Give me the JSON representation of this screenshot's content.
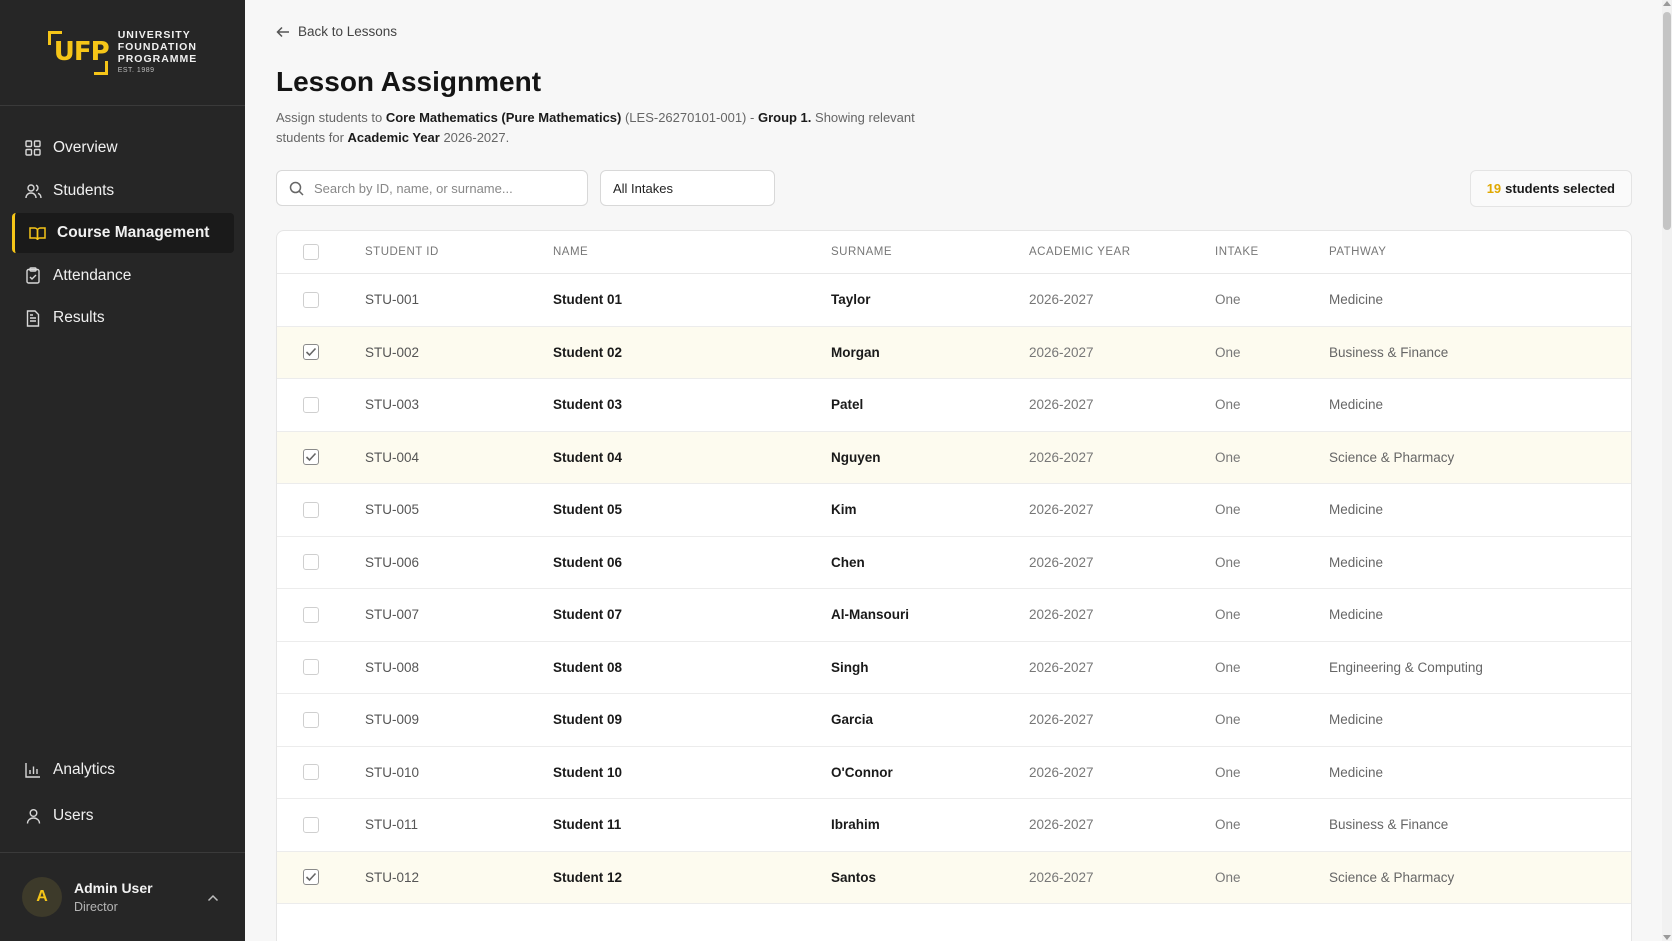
{
  "brand": {
    "logo_letters": "UFP",
    "line1": "UNIVERSITY",
    "line2": "FOUNDATION",
    "line3": "PROGRAMME",
    "est": "EST. 1989",
    "accent_color": "#f5c518"
  },
  "sidebar": {
    "items": [
      {
        "label": "Overview",
        "icon": "grid-icon"
      },
      {
        "label": "Students",
        "icon": "users-icon"
      },
      {
        "label": "Course Management",
        "icon": "book-icon",
        "active": true
      },
      {
        "label": "Attendance",
        "icon": "clipboard-check-icon"
      },
      {
        "label": "Results",
        "icon": "document-icon"
      }
    ],
    "bottom_items": [
      {
        "label": "Analytics",
        "icon": "bar-chart-icon"
      },
      {
        "label": "Users",
        "icon": "user-icon"
      }
    ]
  },
  "user": {
    "initial": "A",
    "name": "Admin User",
    "role": "Director"
  },
  "header": {
    "back_label": "Back to Lessons",
    "title": "Lesson Assignment",
    "subtitle": {
      "prefix": "Assign students to ",
      "course": "Core Mathematics (Pure Mathematics)",
      "code": " (LES-26270101-001) - ",
      "group": "Group 1.",
      "middle": " Showing relevant students for ",
      "year_label": "Academic Year",
      "year": " 2026-2027."
    }
  },
  "filters": {
    "search_placeholder": "Search by ID, name, or surname...",
    "intake_value": "All Intakes"
  },
  "selection": {
    "count": "19",
    "label": "students selected"
  },
  "table": {
    "columns": {
      "id": "STUDENT ID",
      "name": "NAME",
      "surname": "SURNAME",
      "year": "ACADEMIC YEAR",
      "intake": "INTAKE",
      "pathway": "PATHWAY"
    },
    "rows": [
      {
        "id": "STU-001",
        "name": "Student 01",
        "surname": "Taylor",
        "year": "2026-2027",
        "intake": "One",
        "pathway": "Medicine",
        "selected": false
      },
      {
        "id": "STU-002",
        "name": "Student 02",
        "surname": "Morgan",
        "year": "2026-2027",
        "intake": "One",
        "pathway": "Business & Finance",
        "selected": true
      },
      {
        "id": "STU-003",
        "name": "Student 03",
        "surname": "Patel",
        "year": "2026-2027",
        "intake": "One",
        "pathway": "Medicine",
        "selected": false
      },
      {
        "id": "STU-004",
        "name": "Student 04",
        "surname": "Nguyen",
        "year": "2026-2027",
        "intake": "One",
        "pathway": "Science & Pharmacy",
        "selected": true
      },
      {
        "id": "STU-005",
        "name": "Student 05",
        "surname": "Kim",
        "year": "2026-2027",
        "intake": "One",
        "pathway": "Medicine",
        "selected": false
      },
      {
        "id": "STU-006",
        "name": "Student 06",
        "surname": "Chen",
        "year": "2026-2027",
        "intake": "One",
        "pathway": "Medicine",
        "selected": false
      },
      {
        "id": "STU-007",
        "name": "Student 07",
        "surname": "Al-Mansouri",
        "year": "2026-2027",
        "intake": "One",
        "pathway": "Medicine",
        "selected": false
      },
      {
        "id": "STU-008",
        "name": "Student 08",
        "surname": "Singh",
        "year": "2026-2027",
        "intake": "One",
        "pathway": "Engineering & Computing",
        "selected": false
      },
      {
        "id": "STU-009",
        "name": "Student 09",
        "surname": "Garcia",
        "year": "2026-2027",
        "intake": "One",
        "pathway": "Medicine",
        "selected": false
      },
      {
        "id": "STU-010",
        "name": "Student 10",
        "surname": "O'Connor",
        "year": "2026-2027",
        "intake": "One",
        "pathway": "Medicine",
        "selected": false
      },
      {
        "id": "STU-011",
        "name": "Student 11",
        "surname": "Ibrahim",
        "year": "2026-2027",
        "intake": "One",
        "pathway": "Business & Finance",
        "selected": false
      },
      {
        "id": "STU-012",
        "name": "Student 12",
        "surname": "Santos",
        "year": "2026-2027",
        "intake": "One",
        "pathway": "Science & Pharmacy",
        "selected": true
      }
    ]
  }
}
